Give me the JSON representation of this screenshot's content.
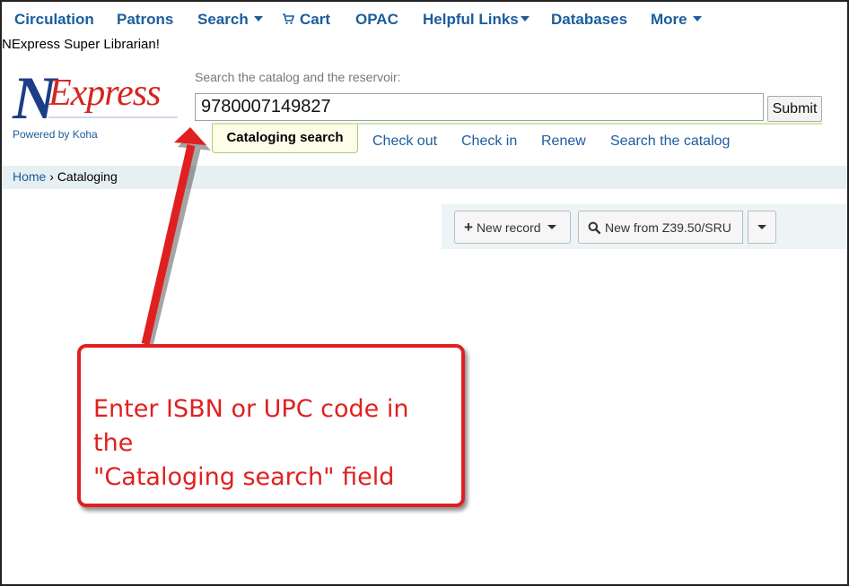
{
  "nav": {
    "items": [
      {
        "label": "Circulation",
        "has_caret": false
      },
      {
        "label": "Patrons",
        "has_caret": false
      },
      {
        "label": "Search",
        "has_caret": true
      },
      {
        "label": "Cart",
        "has_caret": false,
        "icon": "cart-icon"
      },
      {
        "label": "OPAC",
        "has_caret": false
      },
      {
        "label": "Helpful Links",
        "has_caret": true
      },
      {
        "label": "Databases",
        "has_caret": false
      },
      {
        "label": "More",
        "has_caret": true
      }
    ],
    "logged_in_user": "NExpress Super Librarian!"
  },
  "logo": {
    "letter": "N",
    "word": "Express",
    "powered_by": "Powered by Koha"
  },
  "search": {
    "label": "Search the catalog and the reservoir:",
    "value": "9780007149827",
    "submit_label": "Submit",
    "tabs": [
      {
        "label": "Cataloging search",
        "active": true
      },
      {
        "label": "Check out",
        "active": false
      },
      {
        "label": "Check in",
        "active": false
      },
      {
        "label": "Renew",
        "active": false
      },
      {
        "label": "Search the catalog",
        "active": false
      }
    ]
  },
  "breadcrumb": {
    "home": "Home",
    "separator": "›",
    "current": "Cataloging"
  },
  "toolbar": {
    "new_record_label": "New record",
    "new_z3950_label": "New from Z39.50/SRU"
  },
  "annotation": {
    "text_line1": "Enter ISBN or UPC code in the",
    "text_line2": "\"Cataloging search\" field",
    "color": "#e02020"
  },
  "colors": {
    "link": "#1b5d9c",
    "logo_blue": "#1b3e86",
    "logo_red": "#d5261f",
    "breadcrumb_bg": "#e6eff2",
    "active_tab_bg": "#fffde8"
  }
}
